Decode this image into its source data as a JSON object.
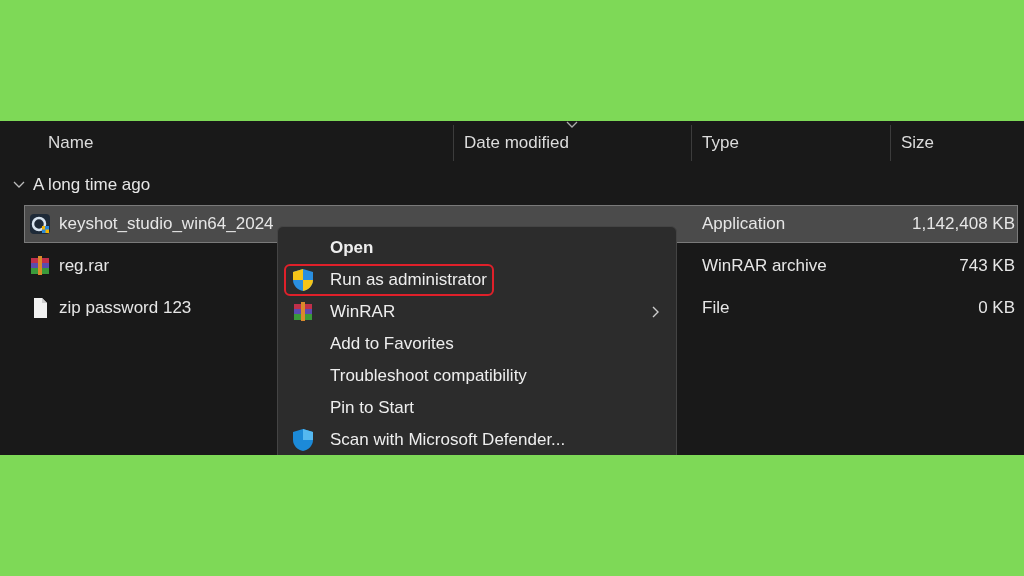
{
  "columns": [
    {
      "label": "Name"
    },
    {
      "label": "Date modified",
      "sorted": true
    },
    {
      "label": "Type"
    },
    {
      "label": "Size"
    }
  ],
  "group": {
    "label": "A long time ago",
    "expanded": true
  },
  "files": [
    {
      "name": "keyshot_studio_win64_2024",
      "kind": "app",
      "type": "Application",
      "size": "1,142,408 KB",
      "selected": true
    },
    {
      "name": "reg.rar",
      "kind": "archive",
      "type": "WinRAR archive",
      "size": "743 KB",
      "selected": false
    },
    {
      "name": "zip password 123",
      "kind": "file",
      "type": "File",
      "size": "0 KB",
      "selected": false
    }
  ],
  "context_menu": {
    "items": [
      {
        "label": "Open",
        "kind": "plain",
        "bold": true,
        "highlighted": false,
        "submenu": false
      },
      {
        "label": "Run as administrator",
        "kind": "shield",
        "bold": false,
        "highlighted": true,
        "submenu": false
      },
      {
        "label": "WinRAR",
        "kind": "archive",
        "bold": false,
        "highlighted": false,
        "submenu": true
      },
      {
        "label": "Add to Favorites",
        "kind": "plain",
        "bold": false,
        "highlighted": false,
        "submenu": false
      },
      {
        "label": "Troubleshoot compatibility",
        "kind": "plain",
        "bold": false,
        "highlighted": false,
        "submenu": false
      },
      {
        "label": "Pin to Start",
        "kind": "plain",
        "bold": false,
        "highlighted": false,
        "submenu": false
      },
      {
        "label": "Scan with Microsoft Defender...",
        "kind": "defender",
        "bold": false,
        "highlighted": false,
        "submenu": false
      }
    ]
  }
}
